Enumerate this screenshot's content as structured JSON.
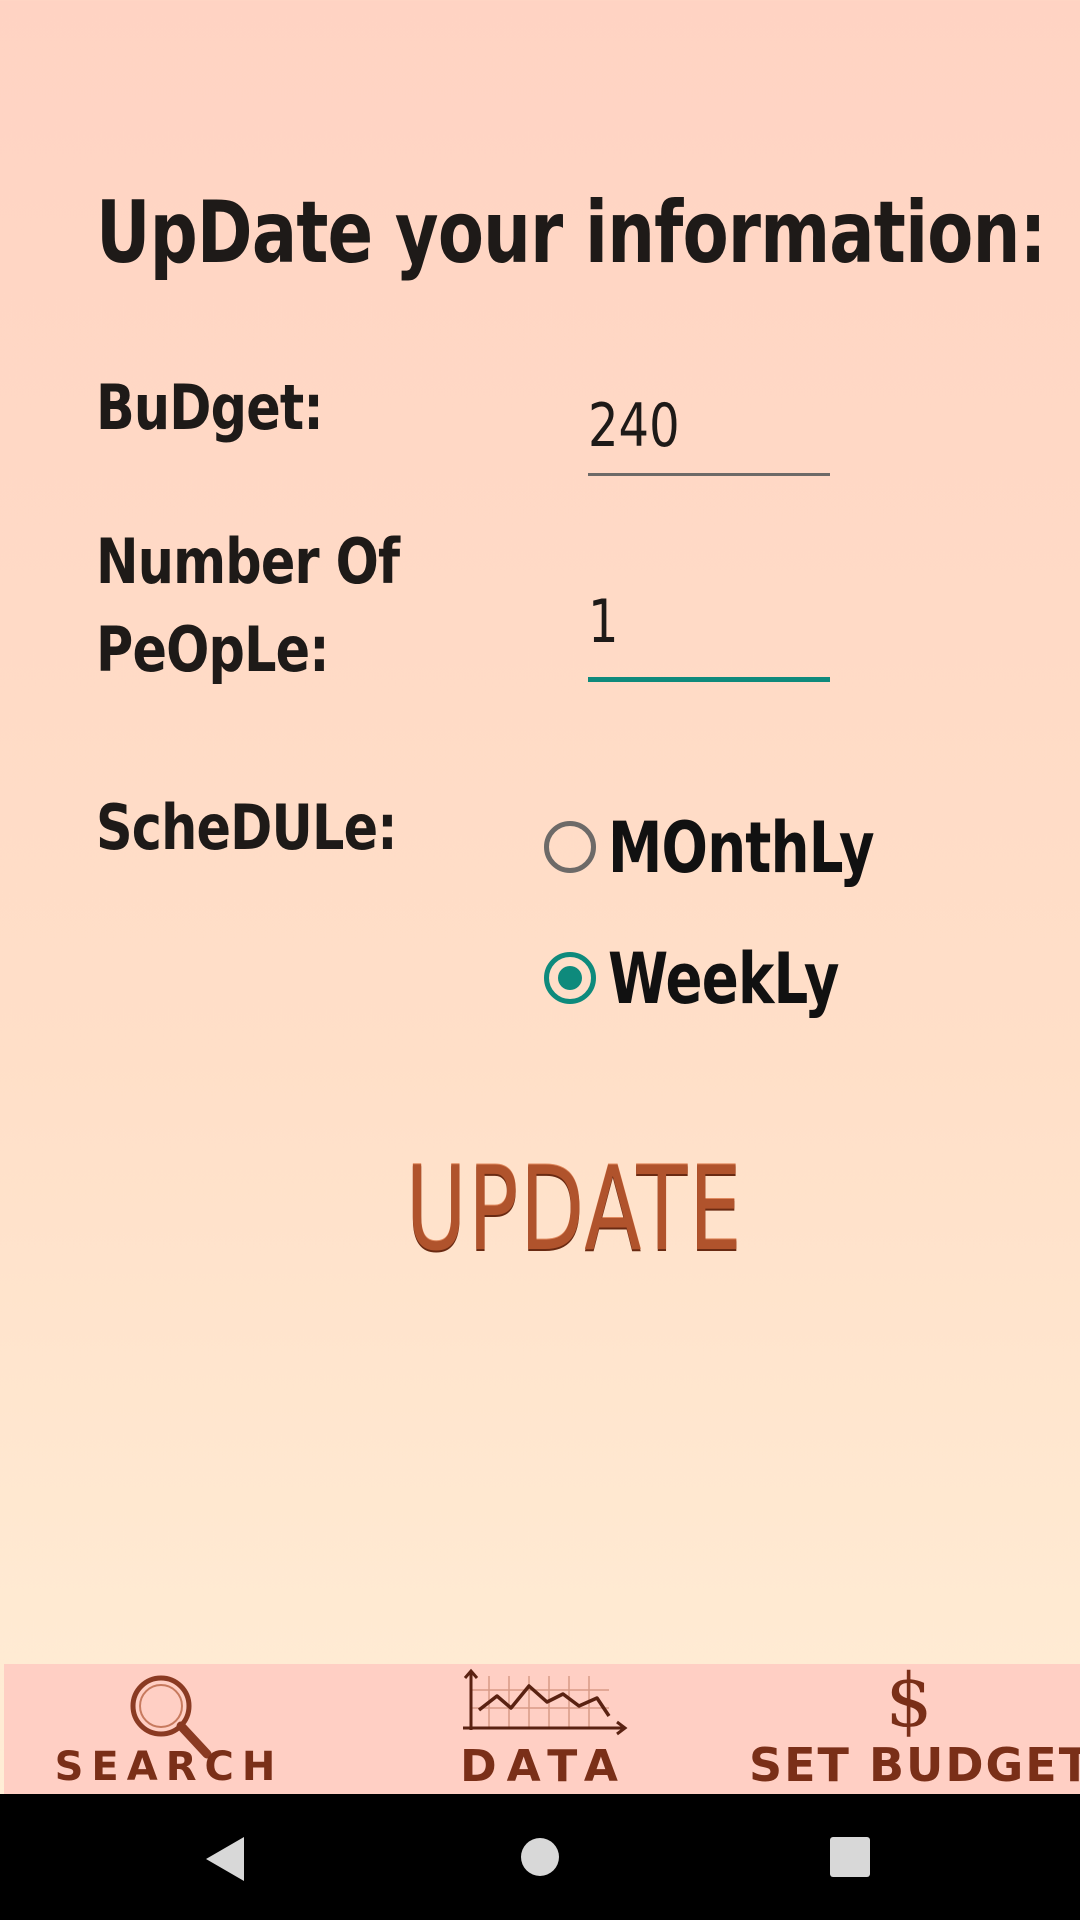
{
  "form": {
    "title": "UpDate your information:",
    "budget_label": "BuDget:",
    "budget_value": "240",
    "people_label_line1": "Number Of",
    "people_label_line2": "PeOpLe:",
    "people_value": "1",
    "schedule_label": "ScheDULe:",
    "schedule_options": [
      {
        "label": "MOnthLy",
        "selected": false
      },
      {
        "label": "WeekLy",
        "selected": true
      }
    ],
    "update_label": "UPDATE"
  },
  "tabs": [
    {
      "label": "SEARCH",
      "icon": "magnifier-icon"
    },
    {
      "label": "DATA",
      "icon": "line-chart-icon"
    },
    {
      "label": "SET BUDGET",
      "icon": "dollar-icon",
      "icon_glyph": "$"
    }
  ],
  "colors": {
    "accent": "#0e8a7c",
    "button_text": "#b0532c",
    "tab_bar": "#ffcfc4",
    "tab_text": "#7a2f18"
  }
}
